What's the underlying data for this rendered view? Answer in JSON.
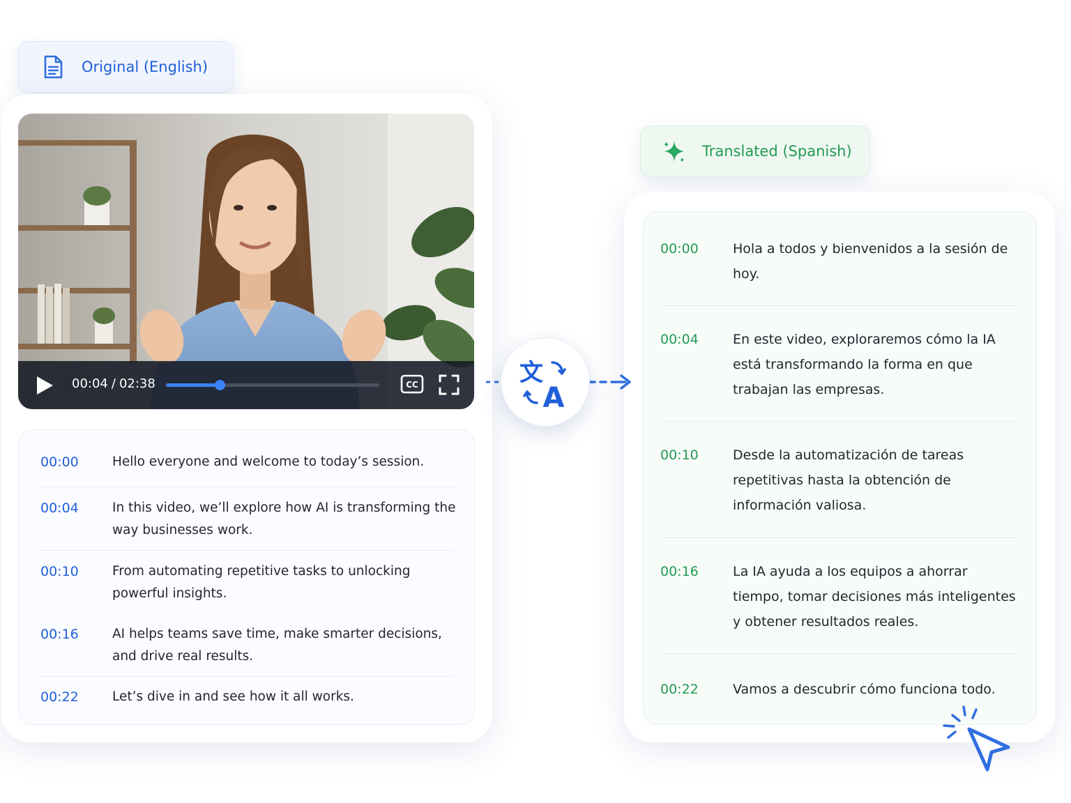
{
  "original_badge": {
    "label": "Original (English)",
    "icon": "document-icon"
  },
  "translated_badge": {
    "label": "Translated (Spanish)",
    "icon": "sparkle-icon"
  },
  "player": {
    "current_time": "00:04",
    "separator": "/",
    "duration": "02:38",
    "progress_fraction": 0.25,
    "icons": [
      "play-icon",
      "closed-captions-icon",
      "fullscreen-icon"
    ],
    "cc_label": "CC"
  },
  "original_transcript": [
    {
      "time": "00:00",
      "text": "Hello everyone and welcome to today’s session."
    },
    {
      "time": "00:04",
      "text": "In this video, we’ll explore how AI is transforming the way businesses work."
    },
    {
      "time": "00:10",
      "text": "From automating repetitive tasks to unlocking powerful insights."
    },
    {
      "time": "00:16",
      "text": "AI helps teams save time, make smarter decisions, and drive real results."
    },
    {
      "time": "00:22",
      "text": "Let’s dive in and see how it all works."
    }
  ],
  "translated_transcript": [
    {
      "time": "00:00",
      "text": "Hola a todos y bienvenidos a la sesión de hoy."
    },
    {
      "time": "00:04",
      "text": "En este video, exploraremos cómo la IA está transformando la forma en que trabajan las empresas."
    },
    {
      "time": "00:10",
      "text": "Desde la automatización de tareas repetitivas hasta la obtención de información valiosa."
    },
    {
      "time": "00:16",
      "text": "La IA ayuda a los equipos a ahorrar tiempo, tomar decisiones más inteligentes y obtener resultados reales."
    },
    {
      "time": "00:22",
      "text": "Vamos a descubrir cómo funciona todo."
    }
  ],
  "translate_icon": {
    "name": "translate-icon",
    "glyph_source": "文",
    "glyph_target": "A"
  },
  "colors": {
    "blue": "#1f5fd8",
    "green": "#239a52",
    "text": "#23262f"
  }
}
